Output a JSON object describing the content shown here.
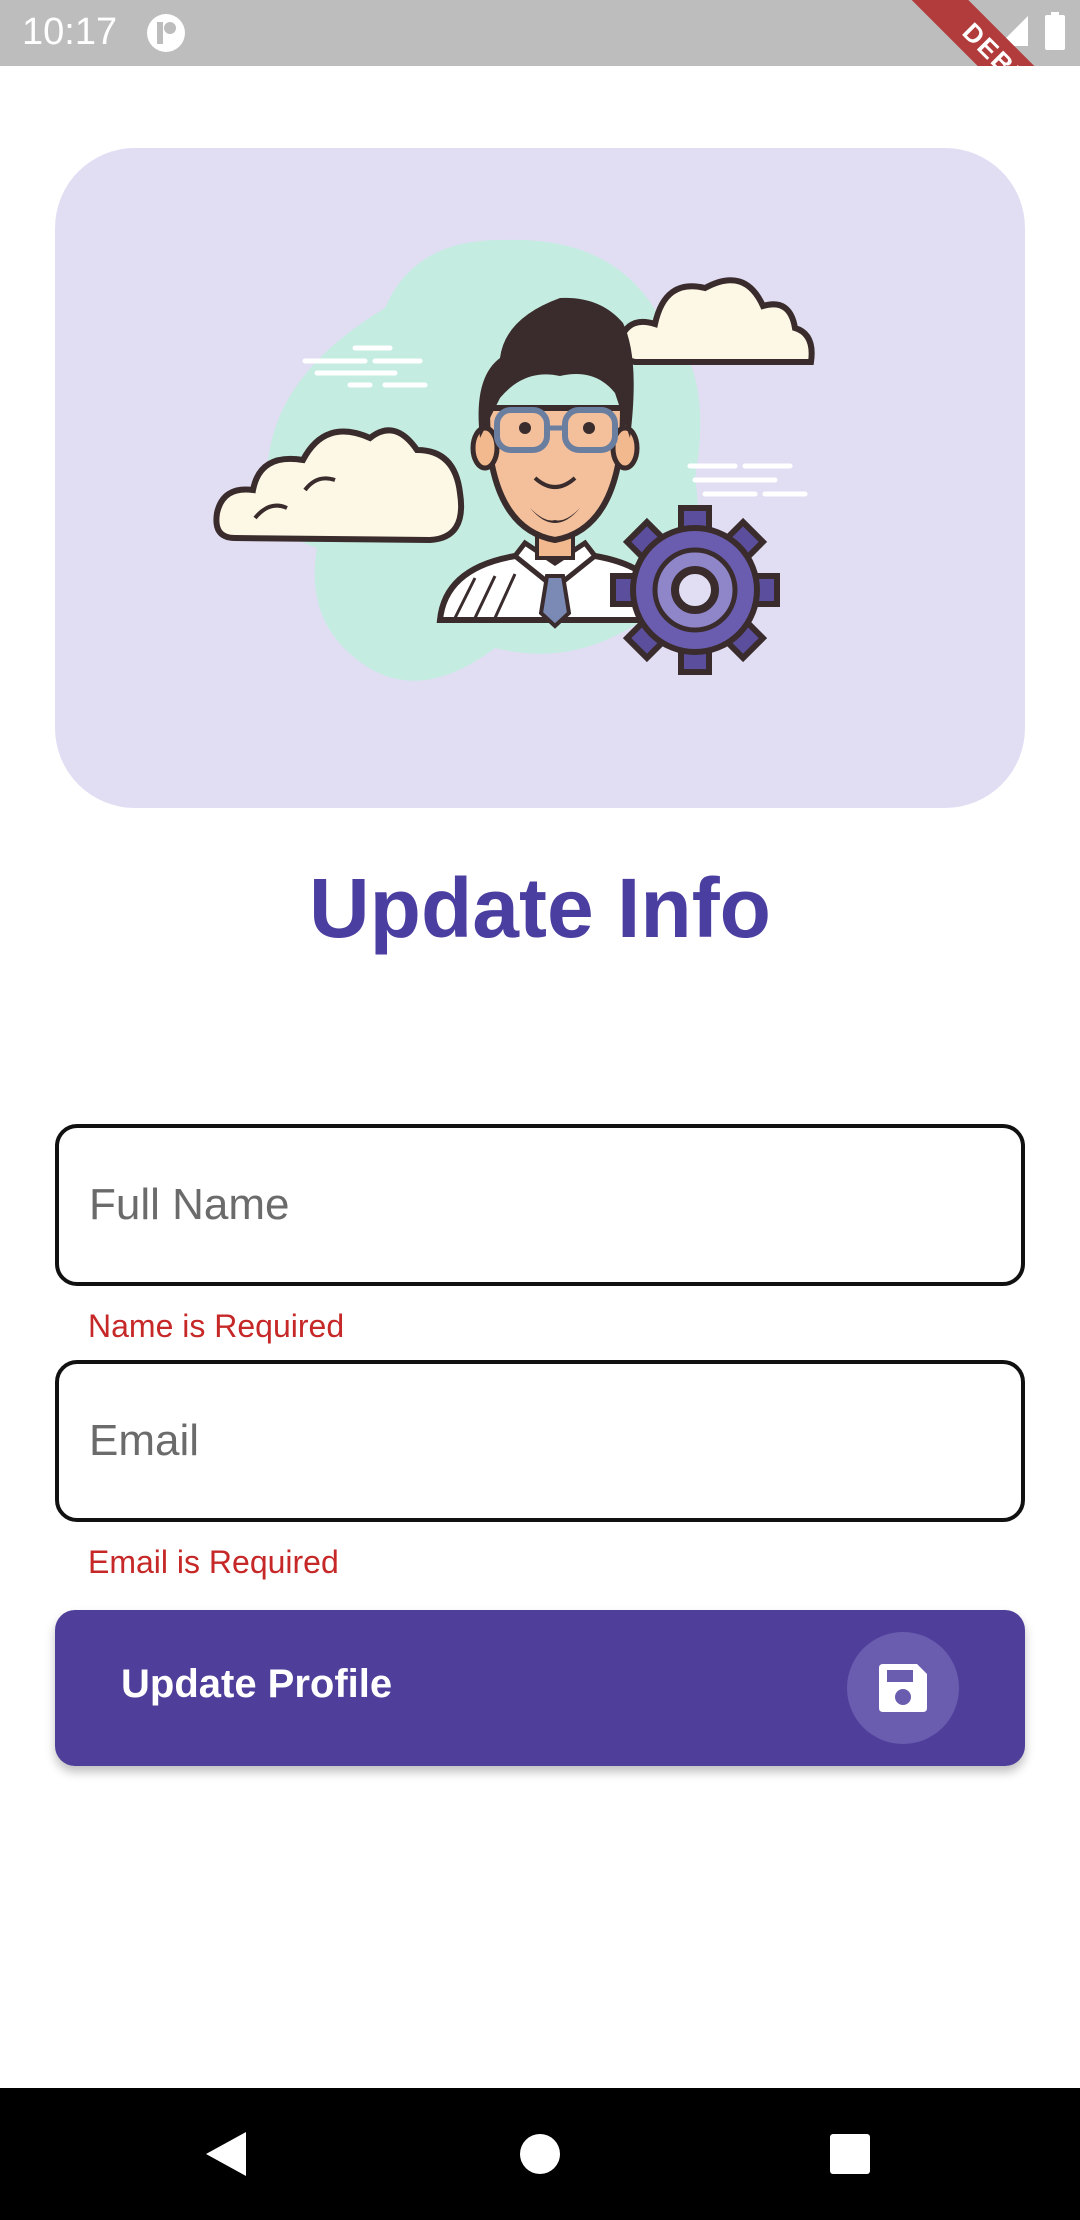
{
  "status_bar": {
    "time": "10:17",
    "debug_label": "DEBUG",
    "icons": [
      "app-notification-icon",
      "wifi-icon",
      "signal-icon",
      "battery-icon"
    ]
  },
  "hero": {
    "illustration": "profile-settings-illustration",
    "background_color": "#e1def4"
  },
  "page": {
    "title": "Update Info"
  },
  "form": {
    "full_name": {
      "placeholder": "Full Name",
      "value": "",
      "error": "Name is Required"
    },
    "email": {
      "placeholder": "Email",
      "value": "",
      "error": "Email is Required"
    }
  },
  "button": {
    "label": "Update Profile",
    "icon": "save-icon",
    "color": "#4f3f9b"
  },
  "nav_bar": {
    "buttons": [
      "back-icon",
      "home-icon",
      "recents-icon"
    ]
  },
  "colors": {
    "accent": "#4a3fa0",
    "error": "#c62828"
  }
}
